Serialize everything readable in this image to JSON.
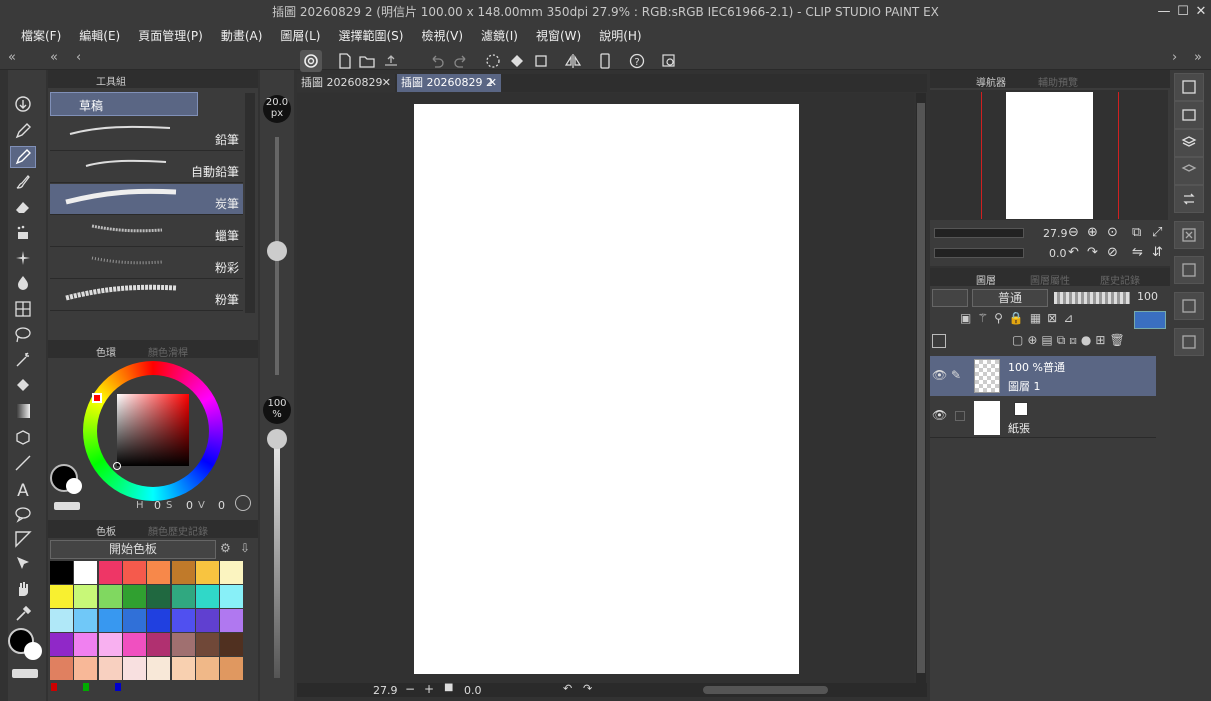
{
  "window": {
    "title": "插圖 20260829 2 (明信片 100.00 x 148.00mm 350dpi 27.9% : RGB:sRGB IEC61966-2.1) - CLIP STUDIO PAINT EX",
    "minimize": "—",
    "maximize": "☐",
    "close": "✕"
  },
  "menu": [
    "檔案(F)",
    "編輯(E)",
    "頁面管理(P)",
    "動畫(A)",
    "圖層(L)",
    "選擇範圍(S)",
    "檢視(V)",
    "濾鏡(I)",
    "視窗(W)",
    "說明(H)"
  ],
  "toolpanel": {
    "tab_label": "工具組",
    "selected_tool": "草稿"
  },
  "brushes": [
    {
      "label": "鉛筆",
      "selected": false
    },
    {
      "label": "自動鉛筆",
      "selected": false
    },
    {
      "label": "炭筆",
      "selected": true
    },
    {
      "label": "蠟筆",
      "selected": false
    },
    {
      "label": "粉彩",
      "selected": false
    },
    {
      "label": "粉筆",
      "selected": false
    }
  ],
  "color_panel": {
    "tab_active": "色環",
    "tab_inactive": "顏色滑桿",
    "h": "0",
    "s": "0",
    "v": "0",
    "h_label": "H",
    "s_label": "S",
    "v_label": "V"
  },
  "palette": {
    "tab_active": "色板",
    "tab_inactive": "顏色歷史記錄",
    "set_name": "開始色板",
    "colors": [
      "#000000",
      "#ffffff",
      "#ee3666",
      "#f55a4c",
      "#f7884a",
      "#c07a2a",
      "#f8c440",
      "#fbf4c0",
      "#f8f030",
      "#c8f878",
      "#80d860",
      "#30a030",
      "#206840",
      "#30a880",
      "#30d8c8",
      "#88f0f8",
      "#b0e8f8",
      "#70c8f8",
      "#3898f0",
      "#3070d8",
      "#2040e0",
      "#5050f0",
      "#6040d0",
      "#b078f0",
      "#9028c8",
      "#f080f0",
      "#f8b0f0",
      "#f050c0",
      "#b03070",
      "#a07070",
      "#704838",
      "#503020",
      "#e08060",
      "#f8b898",
      "#f8d0c0",
      "#f8e0e0",
      "#f8e8d8",
      "#f8d0b0",
      "#f0b888",
      "#e09860"
    ]
  },
  "size_slider": {
    "value": "20.0",
    "unit": "px",
    "level": 0.52
  },
  "opacity_slider": {
    "value": "100",
    "unit": "%",
    "level": 1.0
  },
  "tabs": [
    {
      "label": "插圖 20260829",
      "active": false,
      "close": "✕"
    },
    {
      "label": "插圖 20260829 2",
      "active": true,
      "close": "✕"
    }
  ],
  "canvas_status": {
    "zoom": "27.9",
    "angle": "0.0"
  },
  "navigator": {
    "tab_active": "導航器",
    "tab_inactive": "輔助預覽",
    "zoom": "27.9",
    "angle": "0.0"
  },
  "layer_panel": {
    "tab_active": "圖層",
    "tab_2": "圖層屬性",
    "tab_3": "歷史記錄",
    "blend_mode": "普通",
    "opacity": "100",
    "layers": [
      {
        "mode_text": "100 %普通",
        "name": "圖層 1",
        "selected": true
      },
      {
        "mode_text": "",
        "name": "紙張",
        "selected": false
      }
    ]
  },
  "colors": {
    "accent": "#5a6684",
    "bg": "#323232",
    "panel": "#3b3b3b",
    "hdr": "#2e2e2e"
  }
}
